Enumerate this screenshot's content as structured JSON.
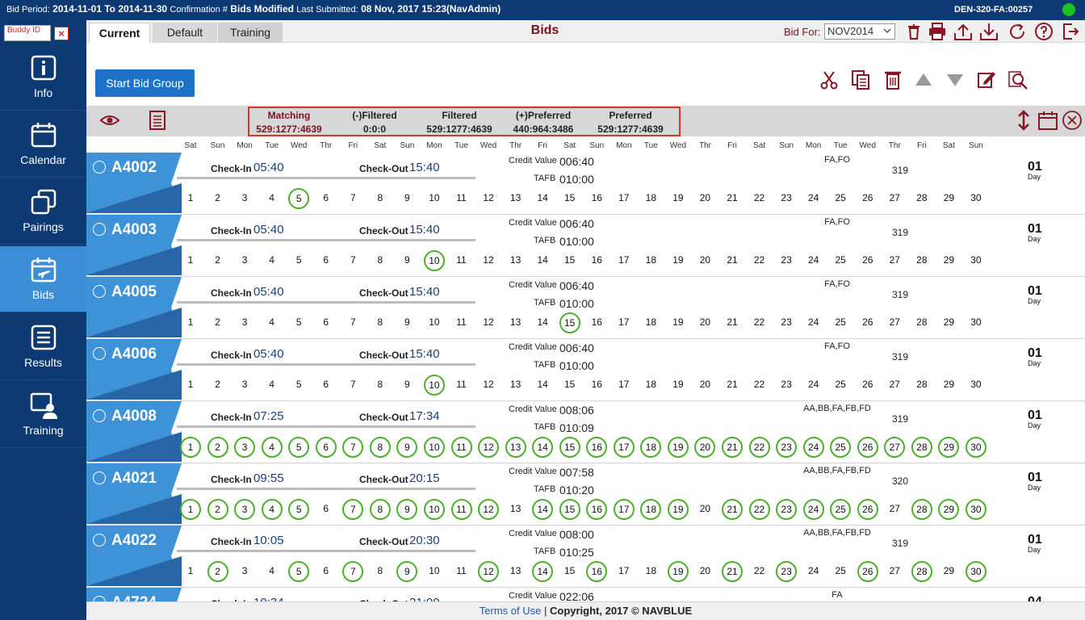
{
  "header": {
    "bid_period_label": "Bid Period:",
    "bid_period_value": "2014-11-01 To 2014-11-30",
    "confirmation_label": "Confirmation #",
    "confirmation_value": "Bids Modified",
    "last_submitted_label": "Last Submitted:",
    "last_submitted_value": "08 Nov, 2017 15:23(NavAdmin)",
    "user_code": "DEN-320-FA:00257",
    "status_color": "#1fc21f"
  },
  "sidebar": {
    "buddy_placeholder": "Buddy ID",
    "buddy_clear": "×",
    "items": [
      {
        "label": "Info",
        "icon": "info-icon"
      },
      {
        "label": "Calendar",
        "icon": "calendar-icon"
      },
      {
        "label": "Pairings",
        "icon": "pairings-icon"
      },
      {
        "label": "Bids",
        "icon": "bids-icon",
        "active": true
      },
      {
        "label": "Results",
        "icon": "results-icon"
      },
      {
        "label": "Training",
        "icon": "training-icon"
      }
    ]
  },
  "tabs": [
    {
      "label": "Current",
      "active": true
    },
    {
      "label": "Default"
    },
    {
      "label": "Training"
    }
  ],
  "page_title": "Bids",
  "bid_for": {
    "label": "Bid For:",
    "value": "NOV2014"
  },
  "toolbar": {
    "start_bid_group": "Start Bid Group"
  },
  "stats": [
    {
      "name": "Matching",
      "value": "529:1277:4639"
    },
    {
      "name": "(-)Filtered",
      "value": "0:0:0"
    },
    {
      "name": "Filtered",
      "value": "529:1277:4639"
    },
    {
      "name": "(+)Preferred",
      "value": "440:964:3486"
    },
    {
      "name": "Preferred",
      "value": "529:1277:4639"
    }
  ],
  "day_names": [
    "Sat",
    "Sun",
    "Mon",
    "Tue",
    "Wed",
    "Thr",
    "Fri",
    "Sat",
    "Sun",
    "Mon",
    "Tue",
    "Wed",
    "Thr",
    "Fri",
    "Sat",
    "Sun",
    "Mon",
    "Tue",
    "Wed",
    "Thr",
    "Fri",
    "Sat",
    "Sun",
    "Mon",
    "Tue",
    "Wed",
    "Thr",
    "Fri",
    "Sat",
    "Sun"
  ],
  "labels": {
    "check_in": "Check-In",
    "check_out": "Check-Out",
    "credit_value": "Credit Value",
    "tafb": "TAFB",
    "day_unit": "Day"
  },
  "pairings": [
    {
      "id": "A4002",
      "check_in": "05:40",
      "check_out": "15:40",
      "credit": "006:40",
      "tafb": "010:00",
      "positions": "FA,FO",
      "num": "319",
      "length": "01",
      "selected_days": [
        5
      ]
    },
    {
      "id": "A4003",
      "check_in": "05:40",
      "check_out": "15:40",
      "credit": "006:40",
      "tafb": "010:00",
      "positions": "FA,FO",
      "num": "319",
      "length": "01",
      "selected_days": [
        10
      ]
    },
    {
      "id": "A4005",
      "check_in": "05:40",
      "check_out": "15:40",
      "credit": "006:40",
      "tafb": "010:00",
      "positions": "FA,FO",
      "num": "319",
      "length": "01",
      "selected_days": [
        15
      ]
    },
    {
      "id": "A4006",
      "check_in": "05:40",
      "check_out": "15:40",
      "credit": "006:40",
      "tafb": "010:00",
      "positions": "FA,FO",
      "num": "319",
      "length": "01",
      "selected_days": [
        10
      ]
    },
    {
      "id": "A4008",
      "check_in": "07:25",
      "check_out": "17:34",
      "credit": "008:06",
      "tafb": "010:09",
      "positions": "AA,BB,FA,FB,FD",
      "num": "319",
      "length": "01",
      "selected_days": [
        1,
        2,
        3,
        4,
        5,
        6,
        7,
        8,
        9,
        10,
        11,
        12,
        13,
        14,
        15,
        16,
        17,
        18,
        19,
        20,
        21,
        22,
        23,
        24,
        25,
        26,
        27,
        28,
        29,
        30
      ]
    },
    {
      "id": "A4021",
      "check_in": "09:55",
      "check_out": "20:15",
      "credit": "007:58",
      "tafb": "010:20",
      "positions": "AA,BB,FA,FB,FD",
      "num": "320",
      "length": "01",
      "selected_days": [
        1,
        2,
        3,
        4,
        5,
        7,
        8,
        9,
        10,
        11,
        12,
        14,
        15,
        16,
        17,
        18,
        19,
        21,
        22,
        23,
        24,
        25,
        26,
        28,
        29,
        30
      ]
    },
    {
      "id": "A4022",
      "check_in": "10:05",
      "check_out": "20:30",
      "credit": "008:00",
      "tafb": "010:25",
      "positions": "AA,BB,FA,FB,FD",
      "num": "319",
      "length": "01",
      "selected_days": [
        2,
        5,
        7,
        9,
        12,
        14,
        16,
        19,
        21,
        23,
        26,
        28,
        30
      ]
    },
    {
      "id": "A4724",
      "check_in": "10:34",
      "check_out": "21:00",
      "credit": "022:06",
      "tafb": "",
      "positions": "FA",
      "num": "",
      "length": "04",
      "selected_days": []
    }
  ],
  "footer": {
    "terms": "Terms of Use",
    "separator": " | ",
    "copyright": "Copyright, 2017 © NAVBLUE"
  },
  "colors": {
    "navy": "#0e3a73",
    "active_nav": "#3c8ed7",
    "tag_blue": "#3e92d8",
    "tag_dark": "#2866a8",
    "maroon": "#7a1020",
    "select_green": "#4caf2e",
    "highlight_red": "#d9362b"
  }
}
